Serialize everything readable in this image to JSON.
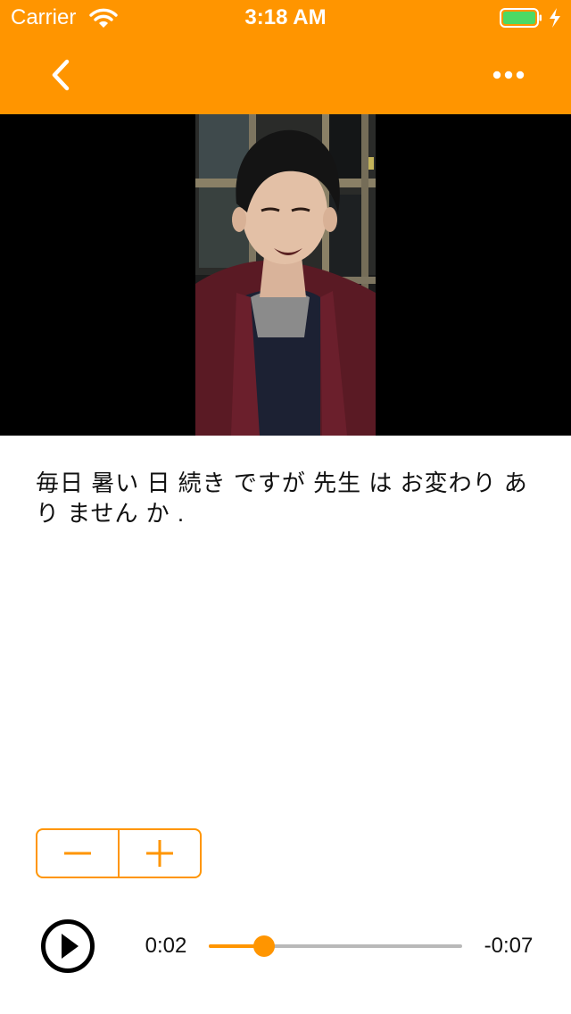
{
  "status_bar": {
    "carrier": "Carrier",
    "time": "3:18 AM",
    "wifi_icon": "wifi-icon",
    "battery_icon": "battery-full-icon",
    "charging_icon": "bolt-icon"
  },
  "nav": {
    "back_icon": "chevron-left-icon",
    "more_icon": "ellipsis-icon"
  },
  "video": {
    "frame": "video-frame"
  },
  "caption": "毎日 暑い 日 続き ですが 先生 は お変わり あり ません か .",
  "stepper": {
    "decrease_icon": "minus-icon",
    "increase_icon": "plus-icon"
  },
  "player": {
    "play_icon": "play-icon",
    "current_time": "0:02",
    "remaining_time": "-0:07",
    "progress": 0.22
  },
  "colors": {
    "accent": "#FF9500",
    "background": "#FFFFFF",
    "video_background": "#000000",
    "track": "#B9B9B9",
    "text": "#111111"
  }
}
